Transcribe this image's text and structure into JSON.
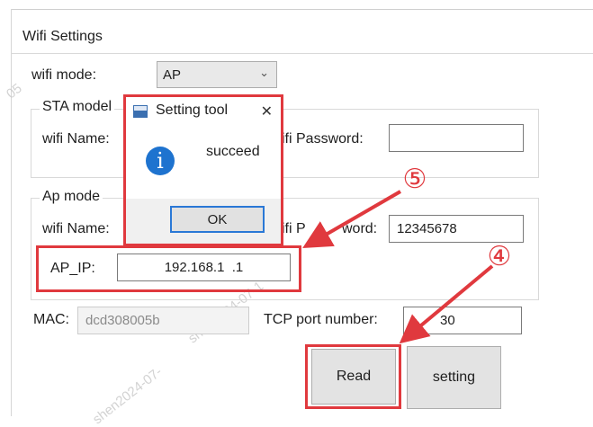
{
  "window": {
    "section_title": "Wifi Settings"
  },
  "wifi_mode": {
    "label": "wifi mode:",
    "value": "AP"
  },
  "sta_group": {
    "title": "STA model",
    "name_label": "wifi Name:",
    "password_label": "ifi Password:",
    "password_value": ""
  },
  "ap_group": {
    "title": "Ap mode",
    "name_label": "wifi Name:",
    "password_label_left": "ifi P",
    "password_label_right": "word:",
    "password_value": "12345678",
    "ip_label": "AP_IP:",
    "ip_value": "192.168.1  .1"
  },
  "mac": {
    "label": "MAC:",
    "value": "dcd308005b"
  },
  "tcp": {
    "label": "TCP port number:",
    "value": "30"
  },
  "buttons": {
    "read": "Read",
    "setting": "setting"
  },
  "dialog": {
    "title": "Setting tool",
    "message": "succeed",
    "ok": "OK",
    "close": "✕",
    "info_glyph": "i"
  },
  "annotations": {
    "step4": "④",
    "step5": "⑤"
  },
  "watermarks": [
    "05",
    "shen2024-07-1",
    "shen2024-07-"
  ],
  "colors": {
    "annotation_red": "#e0393e",
    "info_blue": "#1e73cf",
    "ok_border": "#2a78d6"
  }
}
